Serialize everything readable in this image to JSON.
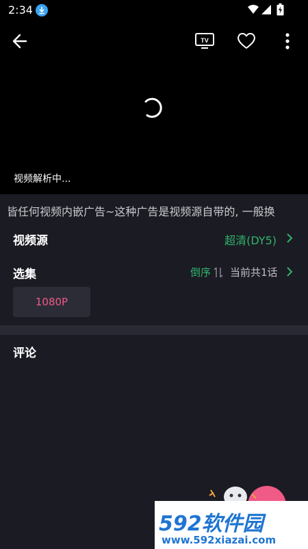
{
  "status_bar": {
    "time": "2:34",
    "icons": [
      "download-icon",
      "wifi-icon",
      "signal-icon",
      "battery-charging-icon"
    ]
  },
  "top_bar": {
    "tv_label": "TV",
    "icons": [
      "back-arrow-icon",
      "tv-cast-icon",
      "heart-icon",
      "more-vertical-icon"
    ]
  },
  "player": {
    "loading_text": "视频解析中..."
  },
  "notice": {
    "text": "皆任何视频内嵌广告~这种广告是视频源自带的, 一般换"
  },
  "source": {
    "title": "视频源",
    "value": "超清(DY5)"
  },
  "episodes": {
    "title": "选集",
    "sort_label": "倒序",
    "total_label": "当前共1话",
    "items": [
      "1080P"
    ]
  },
  "comments": {
    "title": "评论"
  },
  "watermark": {
    "brand": "592软件园",
    "url": "www.592xiazai.com"
  },
  "colors": {
    "accent_green": "#2fb56c",
    "accent_pink": "#f05a86",
    "background": "#1b1b23",
    "watermark_blue": "#1f75d2"
  }
}
